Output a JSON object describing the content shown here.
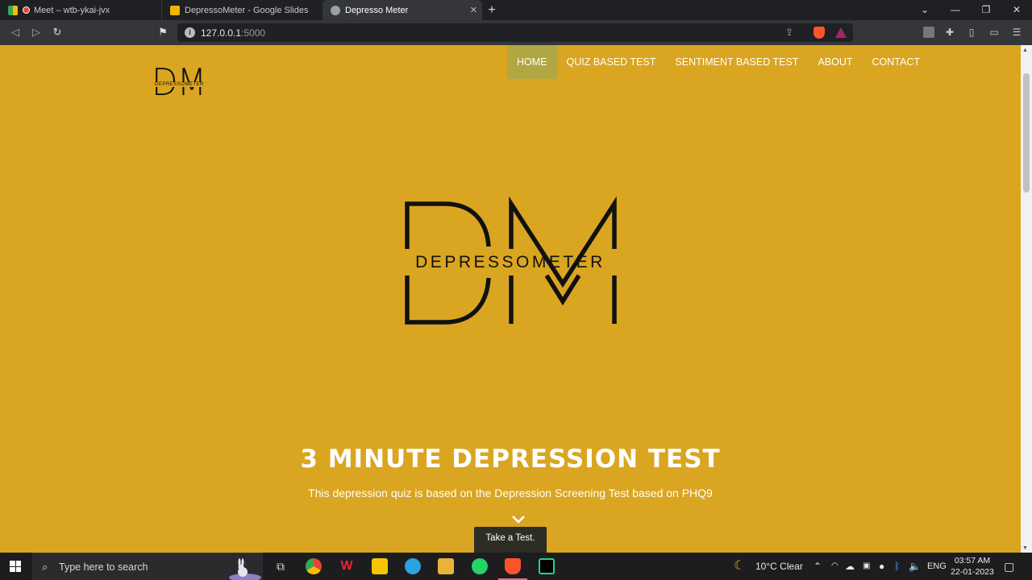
{
  "browser": {
    "tabs": [
      {
        "title": "Meet – wtb-ykai-jvx"
      },
      {
        "title": "DepressoMeter - Google Slides"
      },
      {
        "title": "Depresso Meter"
      }
    ],
    "url_host": "127.0.0.1",
    "url_port": ":5000"
  },
  "site": {
    "logo_letters": "DM",
    "logo_word": "DEPRESSOMETER",
    "nav": [
      {
        "label": "HOME",
        "active": true
      },
      {
        "label": "QUIZ BASED TEST"
      },
      {
        "label": "SENTIMENT BASED TEST"
      },
      {
        "label": "ABOUT"
      },
      {
        "label": "CONTACT"
      }
    ],
    "hero_logo_word": "DEPRESSOMETER",
    "hero_title": "3 MINUTE DEPRESSION TEST",
    "hero_subtitle": "This depression quiz is based on the Depression Screening Test based on PHQ9",
    "cta_label": "Take a Test.",
    "colors": {
      "background": "#daa520",
      "nav_active": "#b0a642",
      "cta": "#2d2d24"
    }
  },
  "taskbar": {
    "search_placeholder": "Type here to search",
    "weather": "10°C  Clear",
    "language": "ENG",
    "time": "03:57 AM",
    "date": "22-01-2023"
  }
}
